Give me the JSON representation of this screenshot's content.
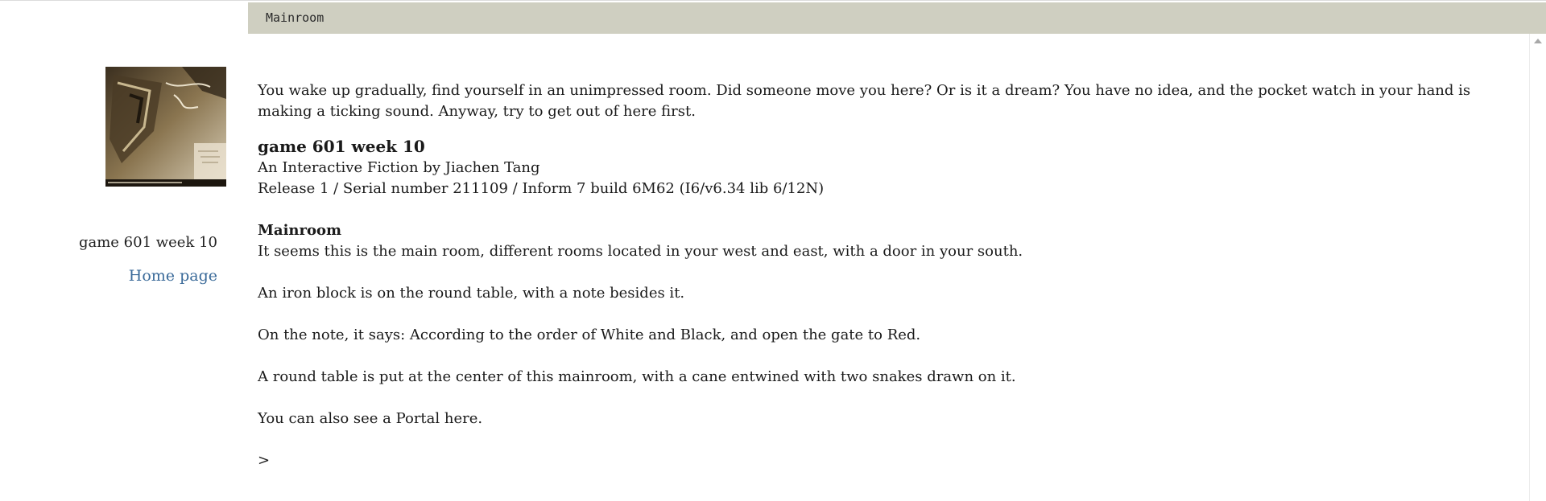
{
  "status": {
    "location": "Mainroom"
  },
  "sidebar": {
    "cover_alt": "game cover image",
    "title": "game 601 week 10",
    "home_link": "Home page"
  },
  "story": {
    "intro": "You wake up gradually, find yourself in an unimpressed room. Did someone move you here? Or is it  a dream? You have no idea, and the pocket watch in your hand is making a ticking sound. Anyway, try to get out of here first.",
    "title": "game 601 week 10",
    "byline": "An Interactive Fiction by Jiachen Tang",
    "release": "Release 1 / Serial number 211109 / Inform 7 build 6M62 (I6/v6.34 lib 6/12N)",
    "room_name": "Mainroom",
    "room_description": "It seems this is the main room, different rooms located in your west and east, with a door in your south.",
    "paragraphs": [
      "An iron block is on the round table, with a note besides it.",
      "On the note, it says: According to the order of White and Black, and open the gate to Red.",
      "A round table is put at the center of this mainroom, with a cane entwined with two snakes drawn on it.",
      "You can also see a Portal here."
    ],
    "prompt": ">"
  }
}
